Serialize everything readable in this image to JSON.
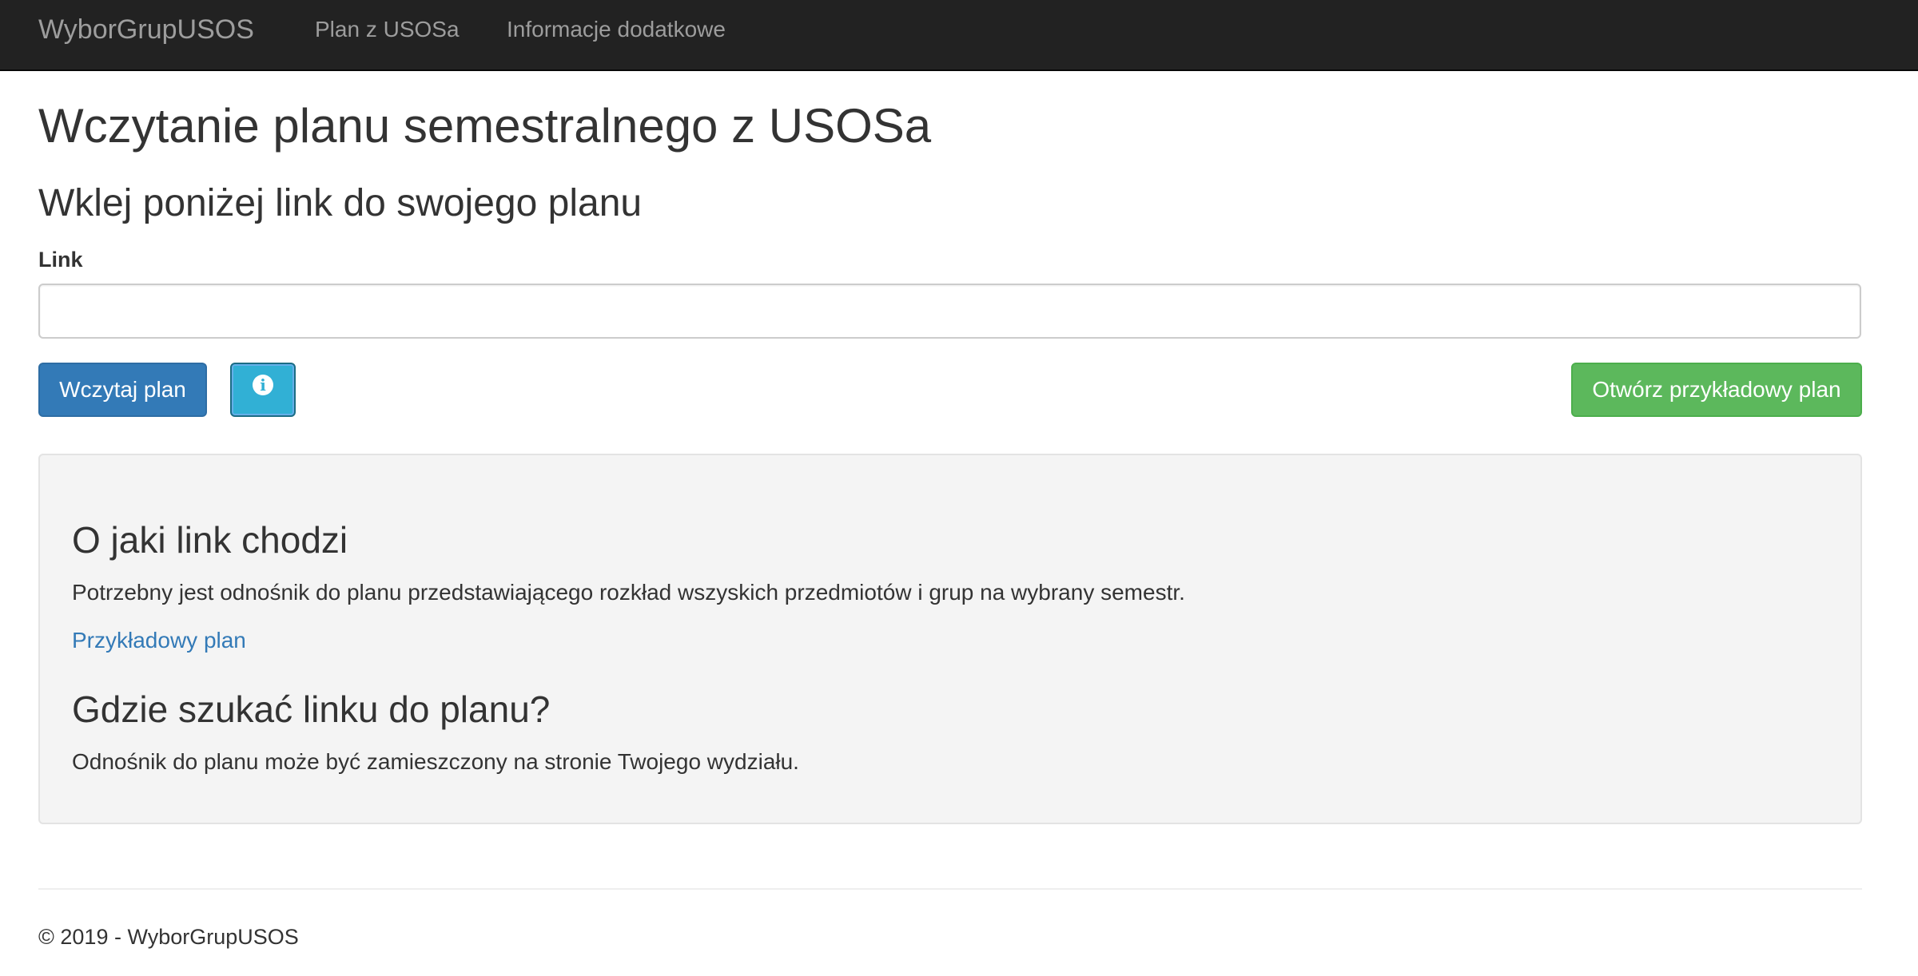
{
  "navbar": {
    "brand": "WyborGrupUSOS",
    "links": [
      {
        "label": "Plan z USOSa"
      },
      {
        "label": "Informacje dodatkowe"
      }
    ],
    "background_color": "#222222"
  },
  "main": {
    "title": "Wczytanie planu semestralnego z USOSa",
    "subtitle": "Wklej poniżej link do swojego planu",
    "link_field": {
      "label": "Link",
      "value": "",
      "placeholder": ""
    },
    "buttons": {
      "load_label": "Wczytaj plan",
      "info_icon": "info-circle-icon",
      "example_label": "Otwórz przykładowy plan"
    },
    "colors": {
      "primary": "#337ab7",
      "info": "#31b0d5",
      "success": "#5cb85c"
    }
  },
  "help_panel": {
    "heading_1": "O jaki link chodzi",
    "text_1": "Potrzebny jest odnośnik do planu przedstawiającego rozkład wszyskich przedmiotów i grup na wybrany semestr.",
    "example_link": "Przykładowy plan",
    "heading_2": "Gdzie szukać linku do planu?",
    "text_2": "Odnośnik do planu może być zamieszczony na stronie Twojego wydziału."
  },
  "footer": {
    "text": "© 2019 - WyborGrupUSOS"
  }
}
